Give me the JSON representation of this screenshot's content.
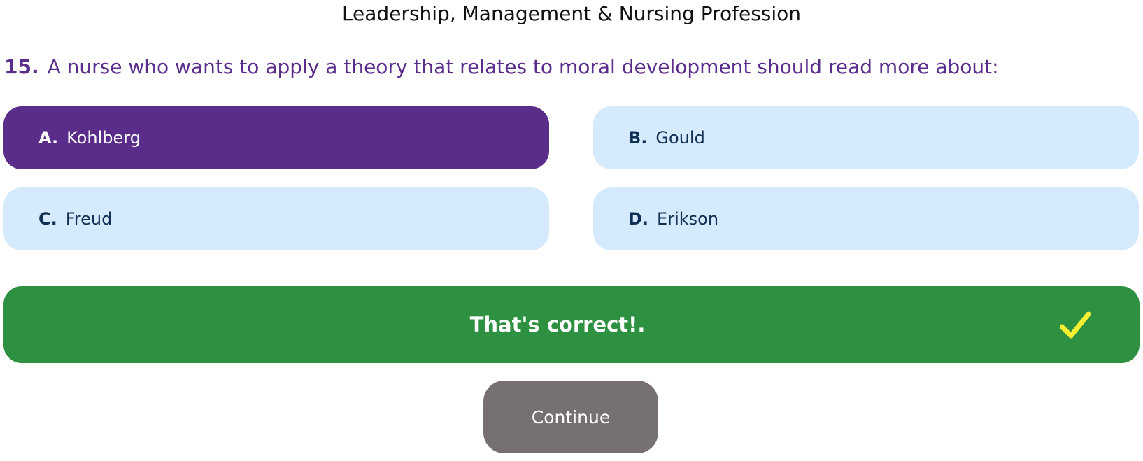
{
  "header": {
    "title": "Leadership, Management & Nursing Profession"
  },
  "question": {
    "number": "15.",
    "text": "A nurse who wants to apply a theory that relates to moral development should read more about:"
  },
  "options": [
    {
      "letter": "A.",
      "label": "Kohlberg",
      "selected": true
    },
    {
      "letter": "B.",
      "label": "Gould",
      "selected": false
    },
    {
      "letter": "C.",
      "label": "Freud",
      "selected": false
    },
    {
      "letter": "D.",
      "label": "Erikson",
      "selected": false
    }
  ],
  "feedback": {
    "text": "That's correct!.",
    "icon": "check-icon",
    "color": "#2e9142",
    "icon_color": "#f5f032"
  },
  "actions": {
    "continue_label": "Continue"
  },
  "colors": {
    "accent": "#5a2d8a",
    "option_bg": "#d6eafd",
    "option_text": "#0f2f55",
    "button_bg": "#767170"
  }
}
